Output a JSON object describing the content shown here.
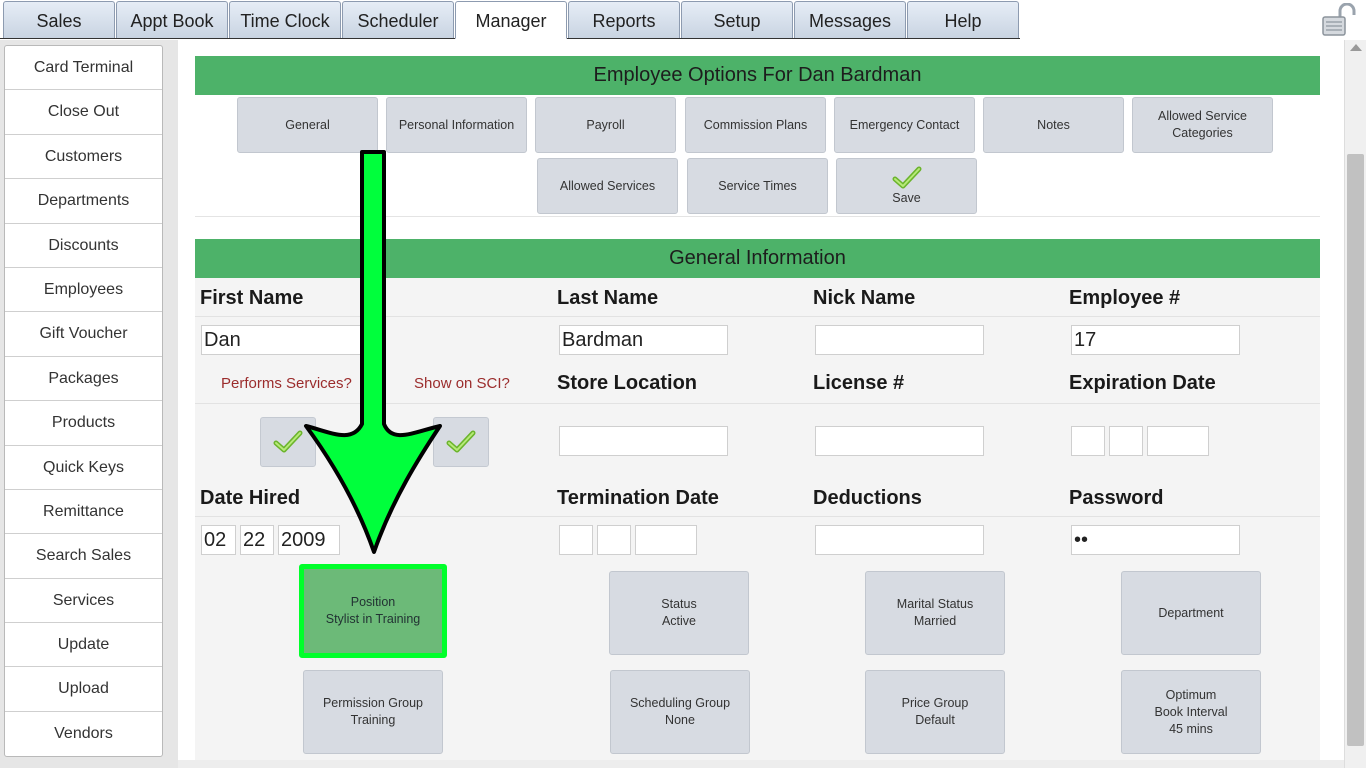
{
  "tabs": [
    "Sales",
    "Appt Book",
    "Time Clock",
    "Scheduler",
    "Manager",
    "Reports",
    "Setup",
    "Messages",
    "Help"
  ],
  "active_tab": "Manager",
  "sidebar": {
    "items": [
      "Card Terminal",
      "Close Out",
      "Customers",
      "Departments",
      "Discounts",
      "Employees",
      "Gift Voucher",
      "Packages",
      "Products",
      "Quick Keys",
      "Remittance",
      "Search Sales",
      "Services",
      "Update",
      "Upload",
      "Vendors"
    ]
  },
  "options": {
    "title": "Employee Options For Dan Bardman",
    "buttons_row1": [
      "General",
      "Personal Information",
      "Payroll",
      "Commission Plans",
      "Emergency Contact",
      "Notes",
      "Allowed Service Categories"
    ],
    "buttons_row2": [
      "Allowed Services",
      "Service Times",
      "Save"
    ]
  },
  "general": {
    "title": "General Information",
    "labels": {
      "first_name": "First Name",
      "last_name": "Last Name",
      "nick_name": "Nick Name",
      "employee_num": "Employee #",
      "performs_services": "Performs Services?",
      "show_on_sci": "Show on SCI?",
      "store_location": "Store Location",
      "license_num": "License #",
      "expiration_date": "Expiration Date",
      "date_hired": "Date Hired",
      "termination_date": "Termination Date",
      "deductions": "Deductions",
      "password": "Password"
    },
    "values": {
      "first_name": "Dan",
      "last_name": "Bardman",
      "nick_name": "",
      "employee_num": "17",
      "store_location": "",
      "license_num": "",
      "exp_month": "",
      "exp_day": "",
      "exp_year": "",
      "hired_month": "02",
      "hired_day": "22",
      "hired_year": "2009",
      "term_month": "",
      "term_day": "",
      "term_year": "",
      "deductions": "",
      "password": "••"
    },
    "performs_services_checked": true,
    "show_on_sci_checked": true,
    "properties_row1": [
      {
        "title": "Position",
        "value": "Stylist in Training"
      },
      {
        "title": "Status",
        "value": "Active"
      },
      {
        "title": "Marital Status",
        "value": "Married"
      },
      {
        "title": "Department",
        "value": ""
      }
    ],
    "properties_row2": [
      {
        "title": "Permission Group",
        "value": "Training"
      },
      {
        "title": "Scheduling Group",
        "value": "None"
      },
      {
        "title": "Price Group",
        "value": "Default"
      },
      {
        "title": "Optimum Book Interval",
        "value": "45 mins"
      }
    ]
  },
  "colors": {
    "header_green": "#4db269",
    "highlight_border": "#00ff2a",
    "arrow_green": "#00ff3c",
    "label_red": "#9b2c2c"
  }
}
